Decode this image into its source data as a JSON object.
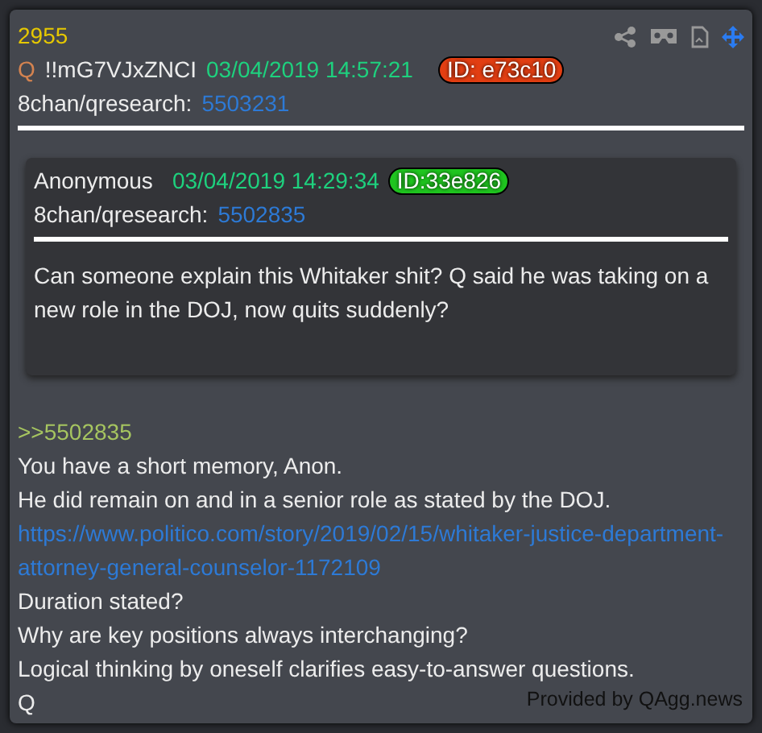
{
  "post": {
    "number": "2955",
    "trip_symbol": "Q",
    "tripcode": "!!mG7VJxZNCI",
    "timestamp": "03/04/2019 14:57:21",
    "id_badge": "ID: e73c10",
    "board": "8chan/qresearch:",
    "post_link": "5503231"
  },
  "quote": {
    "author": "Anonymous",
    "timestamp": "03/04/2019 14:29:34",
    "id_badge": "ID:33e826",
    "board": "8chan/qresearch:",
    "post_link": "5502835",
    "text": "Can someone explain this Whitaker shit?  Q said he was taking on a new role in the DOJ, now quits suddenly?"
  },
  "body": [
    {
      "kind": "reply",
      "text": ">>5502835"
    },
    {
      "kind": "text",
      "text": "You have a short memory, Anon."
    },
    {
      "kind": "text",
      "text": "He did remain on and in a senior role as stated by the DOJ."
    },
    {
      "kind": "link",
      "text": "https://www.politico.com/story/2019/02/15/whitaker-justice-department-attorney-general-counselor-1172109"
    },
    {
      "kind": "text",
      "text": "Duration stated?"
    },
    {
      "kind": "text",
      "text": "Why are key positions always interchanging?"
    },
    {
      "kind": "text",
      "text": "Logical thinking by oneself clarifies easy-to-answer questions."
    },
    {
      "kind": "text",
      "text": "Q"
    }
  ],
  "footer": "Provided by QAgg.news"
}
